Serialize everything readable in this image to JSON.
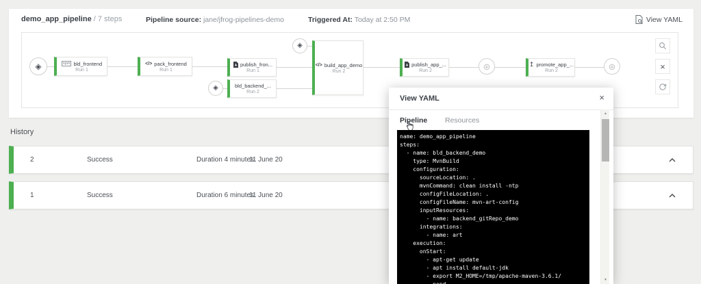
{
  "colors": {
    "success_green": "#4caf50",
    "code_bg": "#000000",
    "page_bg": "#efefed"
  },
  "header": {
    "title": "demo_app_pipeline",
    "steps_suffix": "/ 7 steps",
    "pipeline_source_label": "Pipeline source:",
    "pipeline_source_value": "jane/jfrog-pipelines-demo",
    "triggered_at_label": "Triggered At:",
    "triggered_at_value": "Today at 2:50 PM",
    "view_yaml_label": "View YAML"
  },
  "diagram": {
    "steps": [
      {
        "name": "bld_frontend",
        "run": "Run 1"
      },
      {
        "name": "pack_frontend",
        "run": "Run 1"
      },
      {
        "name": "publish_fron...",
        "run": "Run 1"
      },
      {
        "name": "bld_backend_...",
        "run": "Run 2"
      },
      {
        "name": "build_app_demo",
        "run": "Run 2"
      },
      {
        "name": "publish_app_...",
        "run": "Run 2"
      },
      {
        "name": "promote_app_...",
        "run": "Run 2"
      }
    ],
    "glyphs": {
      "npm": "npm",
      "code": "</>",
      "promote": "↥",
      "git_repo": "◈",
      "build_info": "⊛"
    }
  },
  "toolbar": {
    "close_glyph": "×"
  },
  "history": {
    "label": "History",
    "rows": [
      {
        "run_number": "2",
        "status": "Success",
        "duration": "Duration 4 minutes",
        "date": "11 June 20"
      },
      {
        "run_number": "1",
        "status": "Success",
        "duration": "Duration 6 minutes",
        "date": "11 June 20"
      }
    ]
  },
  "modal": {
    "title": "View YAML",
    "close_glyph": "×",
    "tabs": {
      "pipeline": "Pipeline",
      "resources": "Resources"
    },
    "yaml_lines": [
      "name: demo_app_pipeline",
      "steps:",
      "  - name: bld_backend_demo",
      "    type: MvnBuild",
      "    configuration:",
      "      sourceLocation: .",
      "      mvnCommand: clean install -ntp",
      "      configFileLocation: .",
      "      configFileName: mvn-art-config",
      "      inputResources:",
      "        - name: backend_gitRepo_demo",
      "      integrations:",
      "        - name: art",
      "    execution:",
      "      onStart:",
      "        - apt-get update",
      "        - apt install default-jdk",
      "        - export M2_HOME=/tmp/apache-maven-3.6.1/",
      "        - popd"
    ]
  }
}
